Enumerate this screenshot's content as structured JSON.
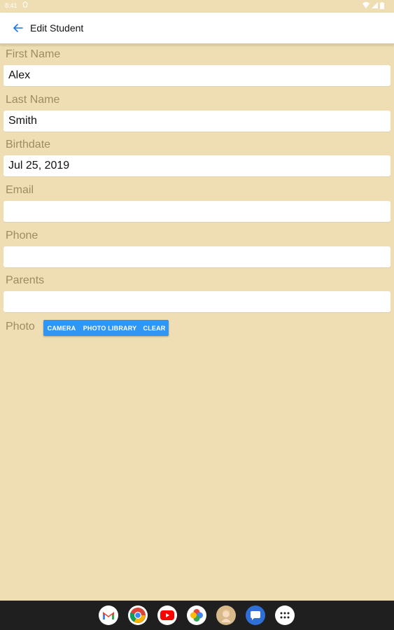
{
  "status_bar": {
    "time": "8:41"
  },
  "app_bar": {
    "title": "Edit Student"
  },
  "form": {
    "first_name": {
      "label": "First Name",
      "value": "Alex"
    },
    "last_name": {
      "label": "Last Name",
      "value": "Smith"
    },
    "birthdate": {
      "label": "Birthdate",
      "value": "Jul 25, 2019"
    },
    "email": {
      "label": "Email",
      "value": ""
    },
    "phone": {
      "label": "Phone",
      "value": ""
    },
    "parents": {
      "label": "Parents",
      "value": ""
    },
    "photo": {
      "label": "Photo",
      "buttons": [
        "CAMERA",
        "PHOTO LIBRARY",
        "CLEAR"
      ]
    }
  },
  "dock": {
    "apps": [
      "gmail-icon",
      "chrome-icon",
      "youtube-icon",
      "photos-icon",
      "contact-avatar-icon",
      "messages-icon",
      "app-drawer-icon"
    ]
  },
  "colors": {
    "background": "#efdeb3",
    "label": "#a08a62",
    "accent_button": "#2f96f3",
    "app_bar": "#ffffff",
    "nav_bar": "#1f1f1f"
  }
}
